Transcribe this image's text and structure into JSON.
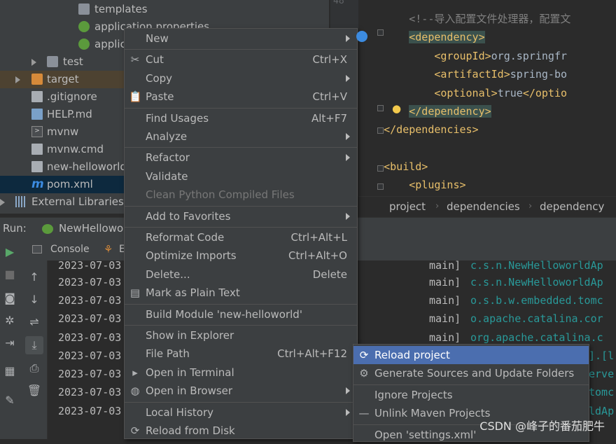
{
  "tree": {
    "items": [
      {
        "label": "templates",
        "icon": "folder-icon"
      },
      {
        "label": "application.properties",
        "icon": "spring-config-icon"
      },
      {
        "label": "applic",
        "icon": "spring-config-icon"
      },
      {
        "label": "test",
        "icon": "folder-icon"
      },
      {
        "label": "target",
        "icon": "folder-icon"
      },
      {
        "label": ".gitignore",
        "icon": "file-icon"
      },
      {
        "label": "HELP.md",
        "icon": "markdown-icon"
      },
      {
        "label": "mvnw",
        "icon": "terminal-file-icon"
      },
      {
        "label": "mvnw.cmd",
        "icon": "file-icon"
      },
      {
        "label": "new-helloworld",
        "icon": "file-icon"
      },
      {
        "label": "pom.xml",
        "icon": "maven-icon"
      },
      {
        "label": "External Libraries",
        "icon": "libraries-icon"
      }
    ]
  },
  "editor": {
    "line_number": "48",
    "lines": [
      {
        "indent": "        ",
        "parts": [
          {
            "t": "cmt",
            "v": "<!--导入配置文件处理器，配置文"
          }
        ]
      },
      {
        "indent": "        ",
        "parts": [
          {
            "t": "hl",
            "v": "<dependency>"
          }
        ]
      },
      {
        "indent": "            ",
        "parts": [
          {
            "t": "tag",
            "v": "<groupId>"
          },
          {
            "t": "txt",
            "v": "org.springfr"
          }
        ]
      },
      {
        "indent": "            ",
        "parts": [
          {
            "t": "tag",
            "v": "<artifactId>"
          },
          {
            "t": "txt",
            "v": "spring-bo"
          }
        ]
      },
      {
        "indent": "            ",
        "parts": [
          {
            "t": "tag",
            "v": "<optional>"
          },
          {
            "t": "txt",
            "v": "true"
          },
          {
            "t": "tag",
            "v": "</optio"
          }
        ]
      },
      {
        "indent": "        ",
        "parts": [
          {
            "t": "hl",
            "v": "</dependency>"
          }
        ]
      },
      {
        "indent": "    ",
        "parts": [
          {
            "t": "tag",
            "v": "</dependencies>"
          }
        ]
      },
      {
        "indent": "",
        "parts": []
      },
      {
        "indent": "    ",
        "parts": [
          {
            "t": "tag",
            "v": "<build>"
          }
        ]
      },
      {
        "indent": "        ",
        "parts": [
          {
            "t": "tag",
            "v": "<plugins>"
          }
        ]
      }
    ],
    "breadcrumbs": [
      "project",
      "dependencies",
      "dependency"
    ]
  },
  "run": {
    "label": "Run:",
    "config": "NewHellowo",
    "tabs": [
      "Console",
      "E"
    ]
  },
  "console": {
    "timestamps": [
      "2023-07-03",
      "2023-07-03",
      "2023-07-03",
      "2023-07-03",
      "2023-07-03",
      "2023-07-03",
      "2023-07-03",
      "2023-07-03",
      "2023-07-03"
    ],
    "right": [
      {
        "thread": "main]",
        "text": "c.s.n.NewHelloworldAp"
      },
      {
        "thread": "main]",
        "text": "c.s.n.NewHelloworldAp"
      },
      {
        "thread": "main]",
        "text": "o.s.b.w.embedded.tomc"
      },
      {
        "thread": "main]",
        "text": "o.apache.catalina.cor"
      },
      {
        "thread": "main]",
        "text": "org.apache.catalina.c"
      },
      {
        "thread": "",
        "text": "].[l"
      },
      {
        "thread": "",
        "text": "erve"
      },
      {
        "thread": "",
        "text": "tomc"
      },
      {
        "thread": "",
        "text": "ldAp"
      }
    ]
  },
  "context_menu": {
    "items": [
      {
        "type": "item",
        "label": "New",
        "submenu": true
      },
      {
        "type": "sep"
      },
      {
        "type": "item",
        "label": "Cut",
        "shortcut": "Ctrl+X",
        "icon": "scissors-icon"
      },
      {
        "type": "item",
        "label": "Copy",
        "submenu": true
      },
      {
        "type": "item",
        "label": "Paste",
        "shortcut": "Ctrl+V",
        "icon": "clipboard-icon"
      },
      {
        "type": "sep"
      },
      {
        "type": "item",
        "label": "Find Usages",
        "shortcut": "Alt+F7"
      },
      {
        "type": "item",
        "label": "Analyze",
        "submenu": true
      },
      {
        "type": "sep"
      },
      {
        "type": "item",
        "label": "Refactor",
        "submenu": true
      },
      {
        "type": "item",
        "label": "Validate"
      },
      {
        "type": "item",
        "label": "Clean Python Compiled Files",
        "disabled": true
      },
      {
        "type": "sep"
      },
      {
        "type": "item",
        "label": "Add to Favorites",
        "submenu": true
      },
      {
        "type": "sep"
      },
      {
        "type": "item",
        "label": "Reformat Code",
        "shortcut": "Ctrl+Alt+L"
      },
      {
        "type": "item",
        "label": "Optimize Imports",
        "shortcut": "Ctrl+Alt+O"
      },
      {
        "type": "item",
        "label": "Delete...",
        "shortcut": "Delete"
      },
      {
        "type": "item",
        "label": "Mark as Plain Text",
        "icon": "plain-text-icon"
      },
      {
        "type": "sep"
      },
      {
        "type": "item",
        "label": "Build Module 'new-helloworld'"
      },
      {
        "type": "sep"
      },
      {
        "type": "item",
        "label": "Show in Explorer"
      },
      {
        "type": "item",
        "label": "File Path",
        "shortcut": "Ctrl+Alt+F12"
      },
      {
        "type": "item",
        "label": "Open in Terminal",
        "icon": "terminal-icon"
      },
      {
        "type": "item",
        "label": "Open in Browser",
        "submenu": true,
        "icon": "globe-icon"
      },
      {
        "type": "sep"
      },
      {
        "type": "item",
        "label": "Local History",
        "submenu": true
      },
      {
        "type": "item",
        "label": "Reload from Disk",
        "icon": "reload-icon"
      }
    ]
  },
  "maven_submenu": {
    "items": [
      {
        "type": "item",
        "label": "Reload project",
        "icon": "reload-icon",
        "hover": true
      },
      {
        "type": "item",
        "label": "Generate Sources and Update Folders",
        "icon": "generate-sources-icon"
      },
      {
        "type": "sep"
      },
      {
        "type": "item",
        "label": "Ignore Projects"
      },
      {
        "type": "item",
        "label": "Unlink Maven Projects",
        "icon": "minus-icon"
      },
      {
        "type": "sep"
      },
      {
        "type": "item",
        "label": "Open 'settings.xml'"
      }
    ]
  },
  "watermark": "CSDN @峰子的番茄肥牛",
  "colors": {
    "accent": "#4b6eaf",
    "panel": "#3c3f41",
    "editor": "#2b2b2b"
  }
}
